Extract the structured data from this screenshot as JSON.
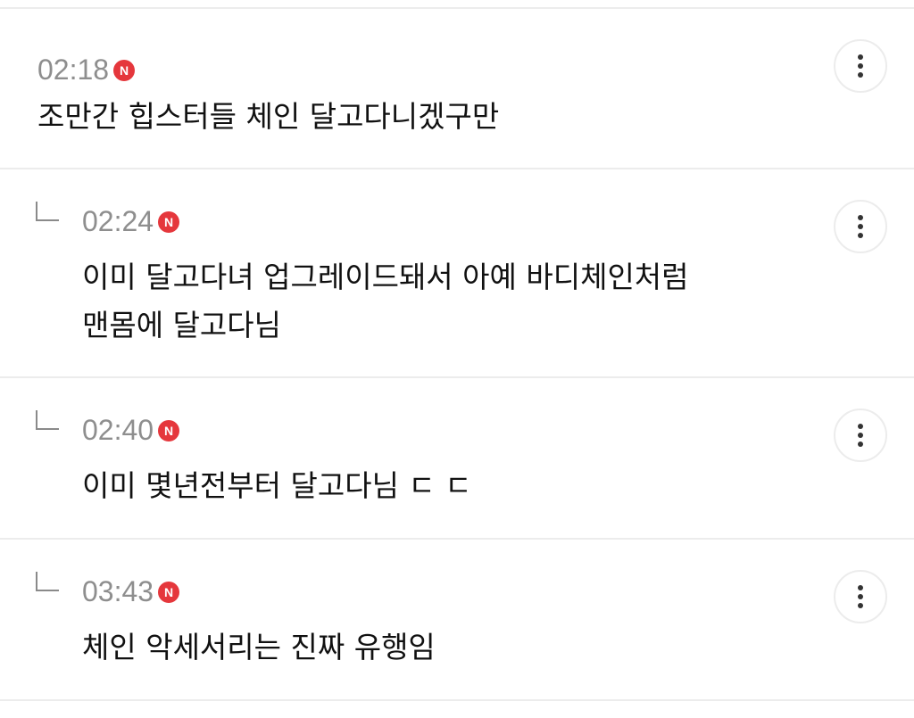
{
  "comments": [
    {
      "time": "02:18",
      "badge": "N",
      "text": "조만간 힙스터들 체인 달고다니겠구만",
      "is_reply": false
    },
    {
      "time": "02:24",
      "badge": "N",
      "text": "이미 달고다녀 업그레이드돼서 아예 바디체인처럼\n맨몸에 달고다님",
      "is_reply": true
    },
    {
      "time": "02:40",
      "badge": "N",
      "text": "이미 몇년전부터 달고다님 ㄷ ㄷ",
      "is_reply": true
    },
    {
      "time": "03:43",
      "badge": "N",
      "text": "체인 악세서리는 진짜 유행임",
      "is_reply": true
    }
  ],
  "icons": {
    "more": "more-vertical-icon",
    "reply": "reply-arrow-icon",
    "new_badge": "new-badge-icon"
  },
  "colors": {
    "badge": "#e5373c",
    "time": "#8e8e8e",
    "divider": "#ececec"
  }
}
